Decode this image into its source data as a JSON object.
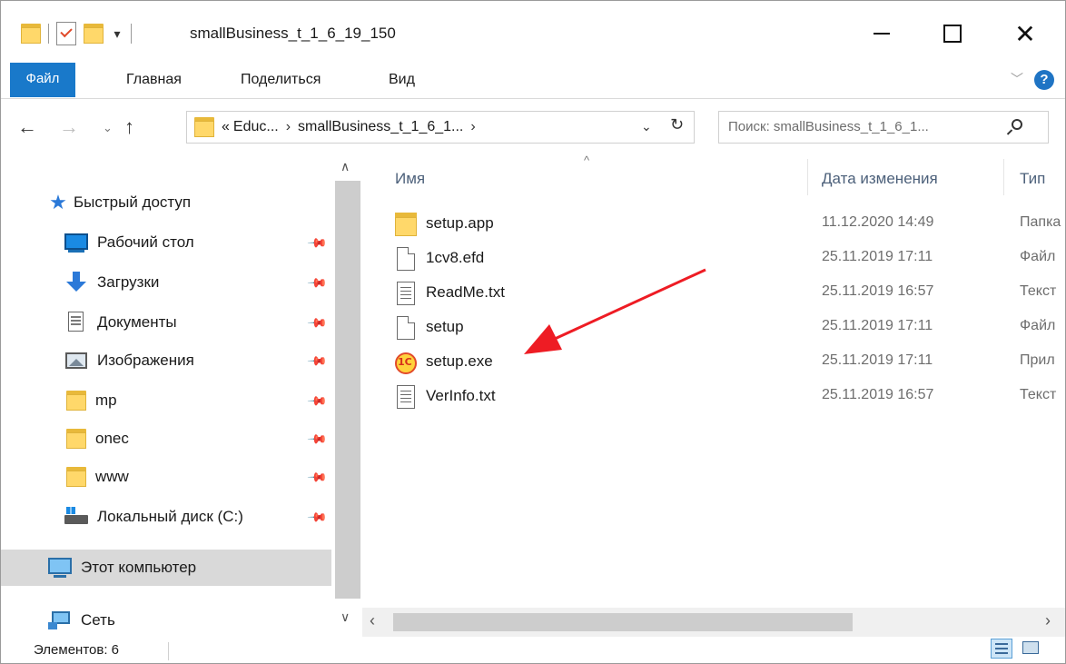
{
  "window": {
    "title": "smallBusiness_t_1_6_19_150"
  },
  "ribbon": {
    "tabs": [
      "Файл",
      "Главная",
      "Поделиться",
      "Вид"
    ],
    "help": "?"
  },
  "address": {
    "prefix": "«",
    "crumbs": [
      "Educ...",
      "smallBusiness_t_1_6_1..."
    ]
  },
  "search": {
    "placeholder": "Поиск: smallBusiness_t_1_6_1..."
  },
  "nav": {
    "items": [
      {
        "label": "Быстрый доступ",
        "icon": "star-icon",
        "pinned": false
      },
      {
        "label": "Рабочий стол",
        "icon": "desktop-icon",
        "pinned": true
      },
      {
        "label": "Загрузки",
        "icon": "downloads-icon",
        "pinned": true
      },
      {
        "label": "Документы",
        "icon": "documents-icon",
        "pinned": true
      },
      {
        "label": "Изображения",
        "icon": "pictures-icon",
        "pinned": true
      },
      {
        "label": "mp",
        "icon": "folder-icon",
        "pinned": true
      },
      {
        "label": "onec",
        "icon": "folder-icon",
        "pinned": true
      },
      {
        "label": "www",
        "icon": "folder-icon",
        "pinned": true
      },
      {
        "label": "Локальный диск (C:)",
        "icon": "drive-icon",
        "pinned": true
      },
      {
        "label": "Этот компьютер",
        "icon": "computer-icon",
        "pinned": false,
        "selected": true
      },
      {
        "label": "Сеть",
        "icon": "network-icon",
        "pinned": false
      }
    ]
  },
  "columns": {
    "name": "Имя",
    "date": "Дата изменения",
    "type": "Тип"
  },
  "files": [
    {
      "name": "setup.app",
      "date": "11.12.2020 14:49",
      "type": "Папка",
      "icon": "folder-icon"
    },
    {
      "name": "1cv8.efd",
      "date": "25.11.2019 17:11",
      "type": "Файл",
      "icon": "file-icon"
    },
    {
      "name": "ReadMe.txt",
      "date": "25.11.2019 16:57",
      "type": "Текст",
      "icon": "text-file-icon"
    },
    {
      "name": "setup",
      "date": "25.11.2019 17:11",
      "type": "Файл",
      "icon": "file-icon"
    },
    {
      "name": "setup.exe",
      "date": "25.11.2019 17:11",
      "type": "Прил",
      "icon": "1c-app-icon"
    },
    {
      "name": "VerInfo.txt",
      "date": "25.11.2019 16:57",
      "type": "Текст",
      "icon": "text-file-icon"
    }
  ],
  "status": {
    "items_count": "Элементов: 6"
  },
  "colors": {
    "accent": "#1979ca",
    "annotation_arrow": "#ee1c24",
    "folder": "#ffd86a"
  }
}
